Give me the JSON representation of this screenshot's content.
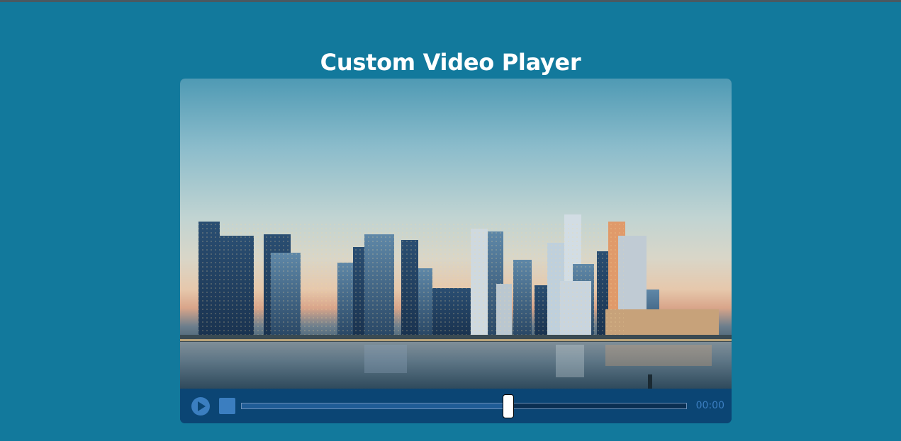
{
  "page": {
    "title": "Custom Video Player"
  },
  "video": {
    "poster_description_icon": "city-skyline-image"
  },
  "controls": {
    "play_icon": "play-icon",
    "stop_icon": "stop-icon",
    "progress_fraction": 0.6,
    "timestamp": "00:00"
  },
  "colors": {
    "background": "#12799c",
    "controls_bg": "#0b4574",
    "accent": "#3b7ec0"
  }
}
